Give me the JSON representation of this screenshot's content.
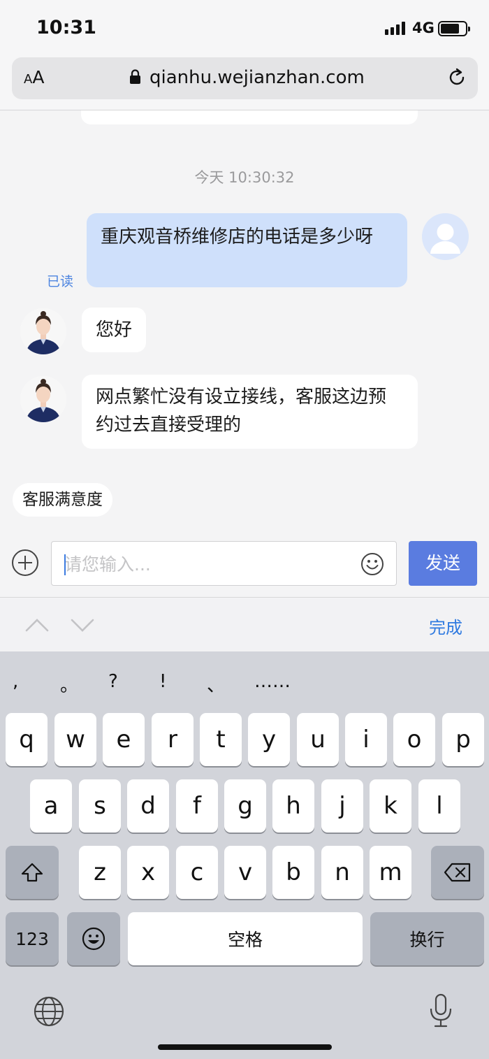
{
  "status_bar": {
    "time": "10:31",
    "network": "4G"
  },
  "browser": {
    "text_size_label": "AA",
    "url": "qianhu.wejianzhan.com"
  },
  "chat": {
    "timestamp": "今天 10:30:32",
    "messages": [
      {
        "from": "user",
        "text": "重庆观音桥维修店的电话是多少呀",
        "read_label": "已读"
      },
      {
        "from": "agent",
        "text": "您好"
      },
      {
        "from": "agent",
        "text": "网点繁忙没有设立接线，客服这边预约过去直接受理的"
      }
    ],
    "satisfaction_label": "客服满意度"
  },
  "composer": {
    "placeholder": "请您输入...",
    "send_label": "发送"
  },
  "keyboard_accessory": {
    "done_label": "完成"
  },
  "keyboard": {
    "punctuation": [
      ",",
      "。",
      "?",
      "!",
      "、",
      "……"
    ],
    "row1": [
      "q",
      "w",
      "e",
      "r",
      "t",
      "y",
      "u",
      "i",
      "o",
      "p"
    ],
    "row2": [
      "a",
      "s",
      "d",
      "f",
      "g",
      "h",
      "j",
      "k",
      "l"
    ],
    "row3": [
      "z",
      "x",
      "c",
      "v",
      "b",
      "n",
      "m"
    ],
    "numbers_label": "123",
    "space_label": "空格",
    "return_label": "换行"
  },
  "icons": {
    "lock": "lock-icon",
    "reload": "reload-icon",
    "plus": "plus-icon",
    "emoji": "emoji-icon",
    "shift": "shift-icon",
    "delete": "delete-icon",
    "globe": "globe-icon",
    "mic": "microphone-icon"
  },
  "colors": {
    "send_button": "#5a7ce0",
    "user_bubble": "#cfe0fb",
    "link_blue": "#2f7ae0"
  }
}
